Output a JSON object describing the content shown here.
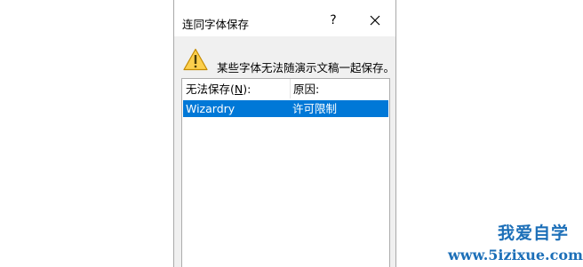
{
  "dialog": {
    "title": "连同字体保存",
    "help_label": "?",
    "close_icon": "close-icon",
    "warning_icon": "warning-icon",
    "message": "某些字体无法随演示文稿一起保存。",
    "list": {
      "columns": [
        {
          "label_prefix": "无法保存(",
          "access_key": "N",
          "label_suffix": "):"
        },
        {
          "label": "原因:"
        }
      ],
      "rows": [
        {
          "font": "Wizardry",
          "reason": "许可限制",
          "selected": true
        }
      ]
    },
    "colors": {
      "selection": "#0078d7",
      "warning_fill": "#fccf4d",
      "warning_border": "#c48a00"
    }
  },
  "watermark": {
    "line1": "我爱自学",
    "line2": "www.5izixue.com",
    "color": "#1c6fb8"
  }
}
